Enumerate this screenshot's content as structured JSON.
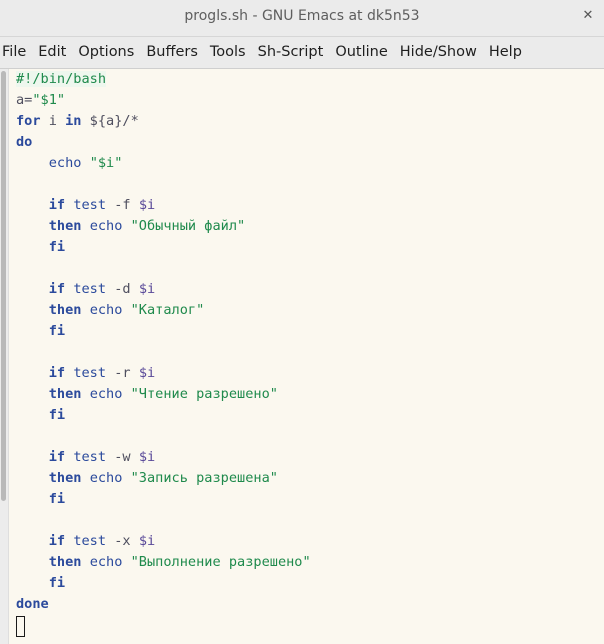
{
  "window": {
    "title": "progls.sh - GNU Emacs at dk5n53",
    "close_glyph": "✕"
  },
  "menubar": {
    "items": [
      "File",
      "Edit",
      "Options",
      "Buffers",
      "Tools",
      "Sh-Script",
      "Outline",
      "Hide/Show",
      "Help"
    ]
  },
  "colors": {
    "keyword": "#2b4a9c",
    "string": "#1f8a4c",
    "variable": "#5a4a99",
    "background": "#fbf8ef"
  },
  "code": {
    "shebang": "#!/bin/bash",
    "l2_var": "a=",
    "l2_str": "\"$1\"",
    "l3_for": "for",
    "l3_i": " i ",
    "l3_in": "in",
    "l3_rest": " ${a}/*",
    "l4_do": "do",
    "l5_echo": "echo",
    "l5_str": "\"$i\"",
    "blocks": [
      {
        "flag": "-f",
        "msg": "\"Обычный файл\""
      },
      {
        "flag": "-d",
        "msg": "\"Каталог\""
      },
      {
        "flag": "-r",
        "msg": "\"Чтение разрешено\""
      },
      {
        "flag": "-w",
        "msg": "\"Запись разрешена\""
      },
      {
        "flag": "-x",
        "msg": "\"Выполнение разрешено\""
      }
    ],
    "kw_if": "if",
    "kw_test": "test",
    "var_i": "$i",
    "kw_then": "then",
    "kw_echo": "echo",
    "kw_fi": "fi",
    "done": "done"
  }
}
